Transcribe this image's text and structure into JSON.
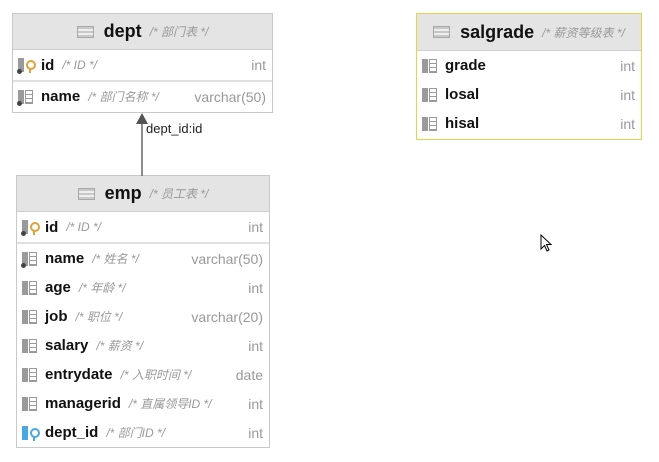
{
  "tables": [
    {
      "name": "dept",
      "comment": "/* 部门表 */",
      "columns": [
        {
          "name": "id",
          "comment": "/* ID */",
          "type": "int",
          "kind": "pk"
        },
        {
          "name": "name",
          "comment": "/* 部门名称 */",
          "type": "varchar(50)",
          "kind": "notnull"
        }
      ]
    },
    {
      "name": "emp",
      "comment": "/* 员工表 */",
      "columns": [
        {
          "name": "id",
          "comment": "/* ID */",
          "type": "int",
          "kind": "pk"
        },
        {
          "name": "name",
          "comment": "/* 姓名 */",
          "type": "varchar(50)",
          "kind": "notnull"
        },
        {
          "name": "age",
          "comment": "/* 年龄 */",
          "type": "int",
          "kind": "col"
        },
        {
          "name": "job",
          "comment": "/* 职位 */",
          "type": "varchar(20)",
          "kind": "col"
        },
        {
          "name": "salary",
          "comment": "/* 薪资 */",
          "type": "int",
          "kind": "col"
        },
        {
          "name": "entrydate",
          "comment": "/* 入职时间 */",
          "type": "date",
          "kind": "col"
        },
        {
          "name": "managerid",
          "comment": "/* 直属领导ID */",
          "type": "int",
          "kind": "col"
        },
        {
          "name": "dept_id",
          "comment": "/* 部门ID */",
          "type": "int",
          "kind": "fk"
        }
      ]
    },
    {
      "name": "salgrade",
      "comment": "/* 薪资等级表 */",
      "columns": [
        {
          "name": "grade",
          "comment": "",
          "type": "int",
          "kind": "col"
        },
        {
          "name": "losal",
          "comment": "",
          "type": "int",
          "kind": "col"
        },
        {
          "name": "hisal",
          "comment": "",
          "type": "int",
          "kind": "col"
        }
      ]
    }
  ],
  "relation": {
    "label": "dept_id:id"
  }
}
